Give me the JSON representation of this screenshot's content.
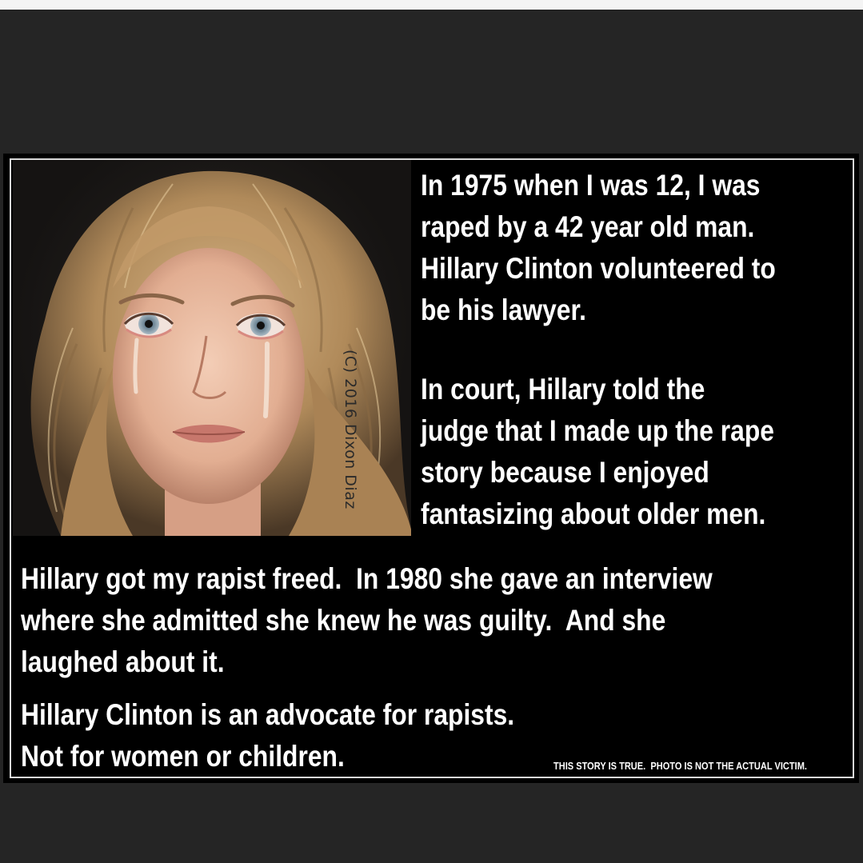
{
  "meme": {
    "watermark": "(C) 2016 Dixon Diaz",
    "paragraph1": [
      "In 1975 when I was 12, I was",
      "raped by a 42 year old man.",
      "Hillary Clinton volunteered to",
      "be his lawyer."
    ],
    "paragraph2": [
      "In court, Hillary told the",
      "judge that I made up the rape",
      "story because I enjoyed",
      "fantasizing about older men."
    ],
    "paragraph3": [
      "Hillary got my rapist freed.  In 1980 she gave an interview",
      "where she admitted she knew he was guilty.  And she",
      "laughed about it."
    ],
    "paragraph4": [
      "Hillary Clinton is an advocate for rapists.",
      "Not for women or children."
    ],
    "disclaimer": "THIS STORY IS TRUE.  PHOTO IS NOT THE ACTUAL VICTIM."
  },
  "colors": {
    "page_background": "#252525",
    "meme_background": "#000000",
    "text": "#ffffff",
    "hair": "#b08a5a",
    "skin": "#e7b9a0"
  }
}
